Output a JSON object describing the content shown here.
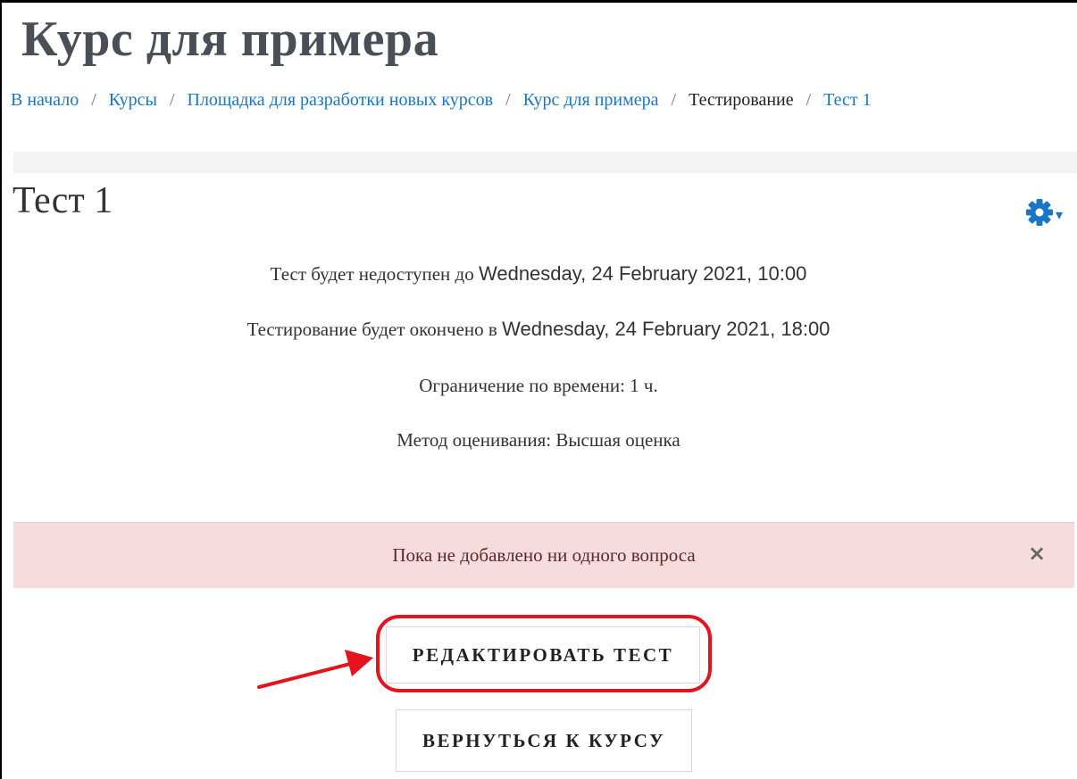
{
  "header": {
    "course_title": "Курс для примера"
  },
  "breadcrumb": {
    "items": [
      {
        "label": "В начало",
        "link": true
      },
      {
        "label": "Курсы",
        "link": true
      },
      {
        "label": "Площадка для разработки новых курсов",
        "link": true
      },
      {
        "label": "Курс для примера",
        "link": true
      },
      {
        "label": "Тестирование",
        "link": false
      },
      {
        "label": "Тест 1",
        "link": true
      }
    ],
    "separator": "/"
  },
  "quiz": {
    "title": "Тест 1",
    "info": {
      "open_prefix": "Тест будет недоступен до",
      "open_date": "Wednesday, 24 February 2021, 10:00",
      "close_prefix": "Тестирование будет окончено в",
      "close_date": "Wednesday, 24 February 2021, 18:00",
      "time_limit": "Ограничение по времени: 1 ч.",
      "grading_method": "Метод оценивания: Высшая оценка"
    }
  },
  "alert": {
    "message": "Пока не добавлено ни одного вопроса",
    "close_symbol": "×"
  },
  "buttons": {
    "edit_quiz": "РЕДАКТИРОВАТЬ ТЕСТ",
    "back_to_course": "ВЕРНУТЬСЯ К КУРСУ"
  },
  "icons": {
    "settings": "gear-icon",
    "settings_menu": "caret-down-icon",
    "annotation_arrow": "arrow-icon"
  },
  "colors": {
    "link": "#1a76c4",
    "alert_bg": "#f6dcdc",
    "highlight": "#e3141b",
    "title": "#4a4f57"
  }
}
